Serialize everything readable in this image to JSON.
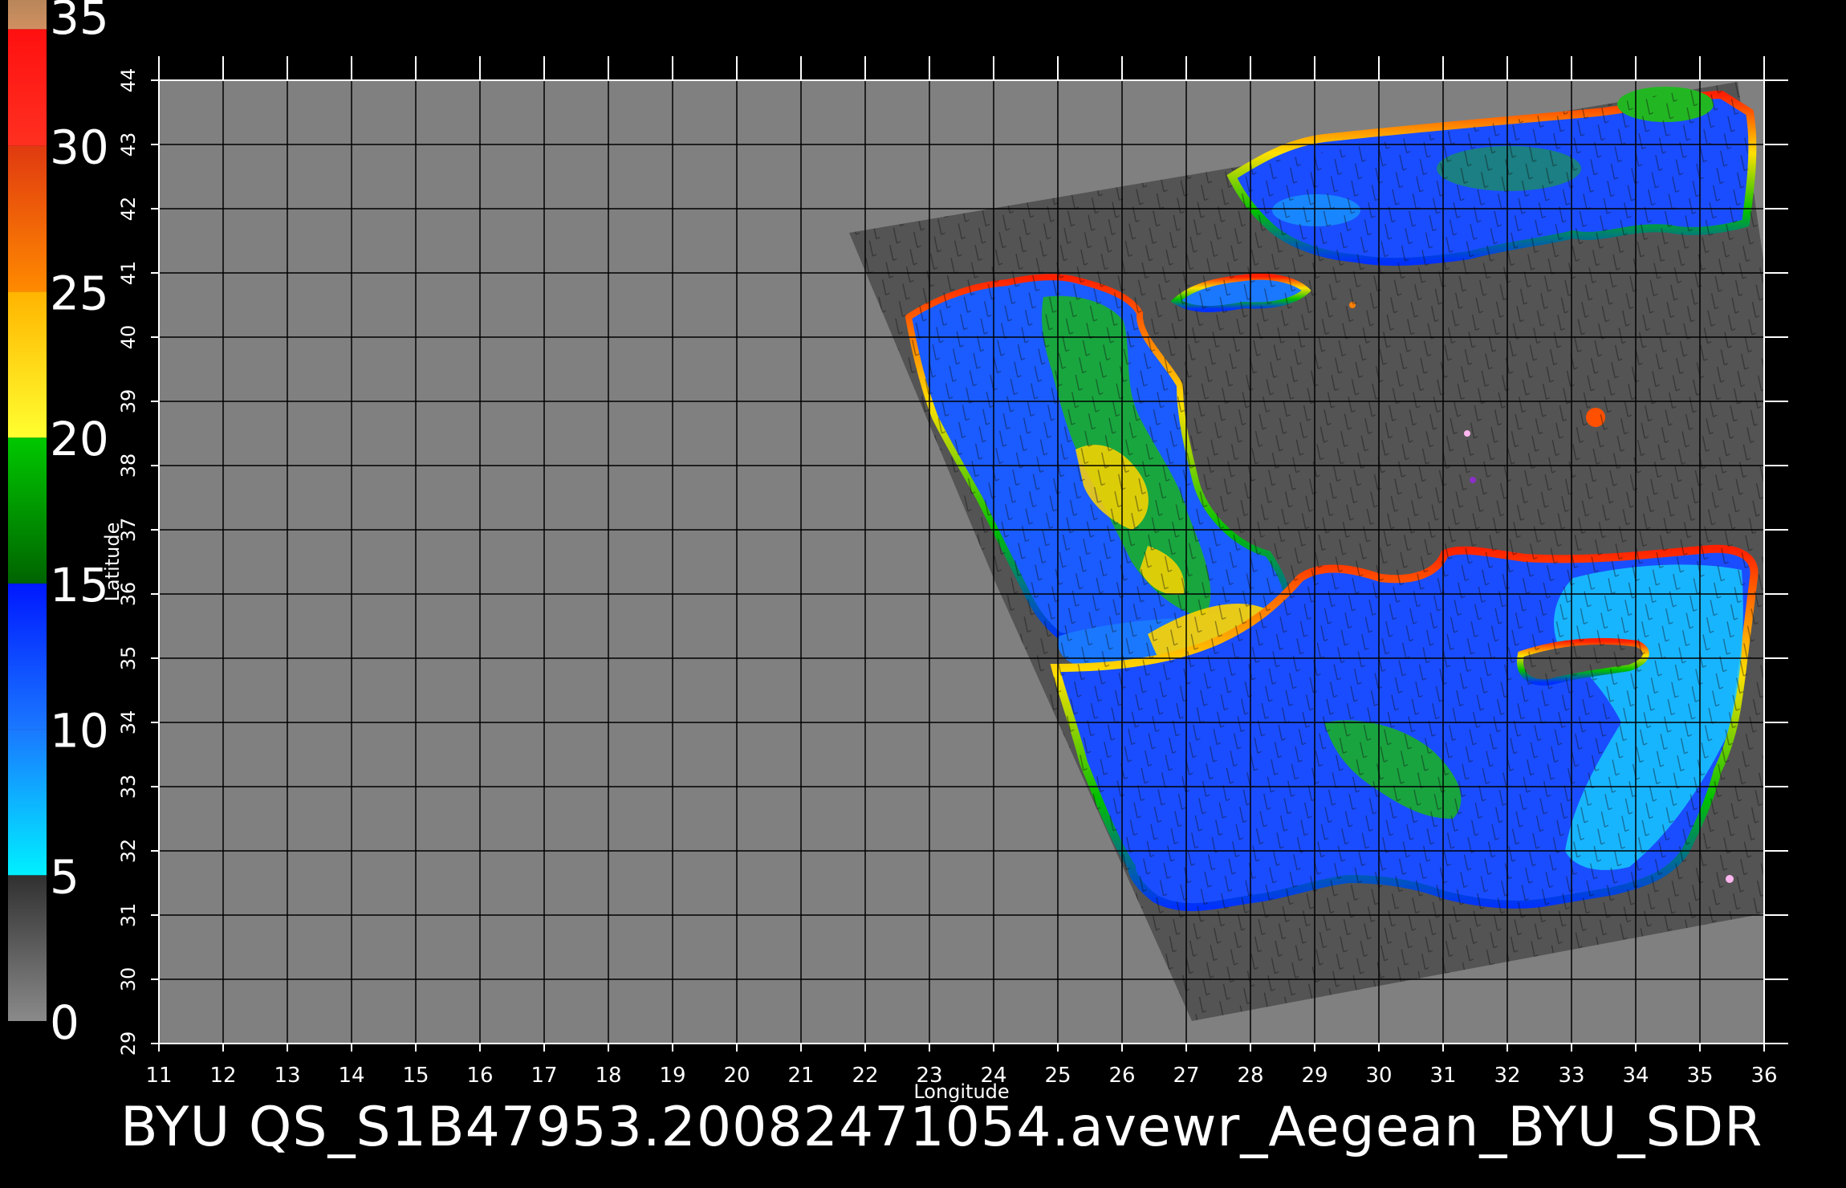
{
  "footer": {
    "caption": "BYU  QS_S1B47953.20082471054.avewr_Aegean_BYU_SDR"
  },
  "axes": {
    "x_label": "Longitude",
    "y_label": "Latitude",
    "x_ticks": [
      "11",
      "12",
      "13",
      "14",
      "15",
      "16",
      "17",
      "18",
      "19",
      "20",
      "21",
      "22",
      "23",
      "24",
      "25",
      "26",
      "27",
      "28",
      "29",
      "30",
      "31",
      "32",
      "33",
      "34",
      "35",
      "36"
    ],
    "y_ticks": [
      "29",
      "30",
      "31",
      "32",
      "33",
      "34",
      "35",
      "36",
      "37",
      "38",
      "39",
      "40",
      "41",
      "42",
      "43",
      "44"
    ]
  },
  "colorbar": {
    "labels": [
      "0",
      "5",
      "10",
      "15",
      "20",
      "25",
      "30",
      "35"
    ],
    "segments": [
      {
        "from": 0,
        "to": 5,
        "top": "#303030",
        "bottom": "#8a8a8a"
      },
      {
        "from": 5,
        "to": 10,
        "top": "#1a78ff",
        "bottom": "#00f0ff"
      },
      {
        "from": 10,
        "to": 15,
        "top": "#0018ff",
        "bottom": "#1a78ff"
      },
      {
        "from": 15,
        "to": 20,
        "top": "#00c800",
        "bottom": "#006400"
      },
      {
        "from": 20,
        "to": 25,
        "top": "#ffb400",
        "bottom": "#ffff30"
      },
      {
        "from": 25,
        "to": 30,
        "top": "#e03a10",
        "bottom": "#ff8a00"
      },
      {
        "from": 30,
        "to": 34,
        "top": "#ff1010",
        "bottom": "#ff3020"
      },
      {
        "from": 34,
        "to": 35,
        "top": "#b8865a",
        "bottom": "#d09060"
      }
    ]
  },
  "colors": {
    "background": "#000000",
    "grid_fill": "#808080",
    "swath_fill": "#545454",
    "grid_line": "#000000",
    "text": "#ffffff"
  }
}
